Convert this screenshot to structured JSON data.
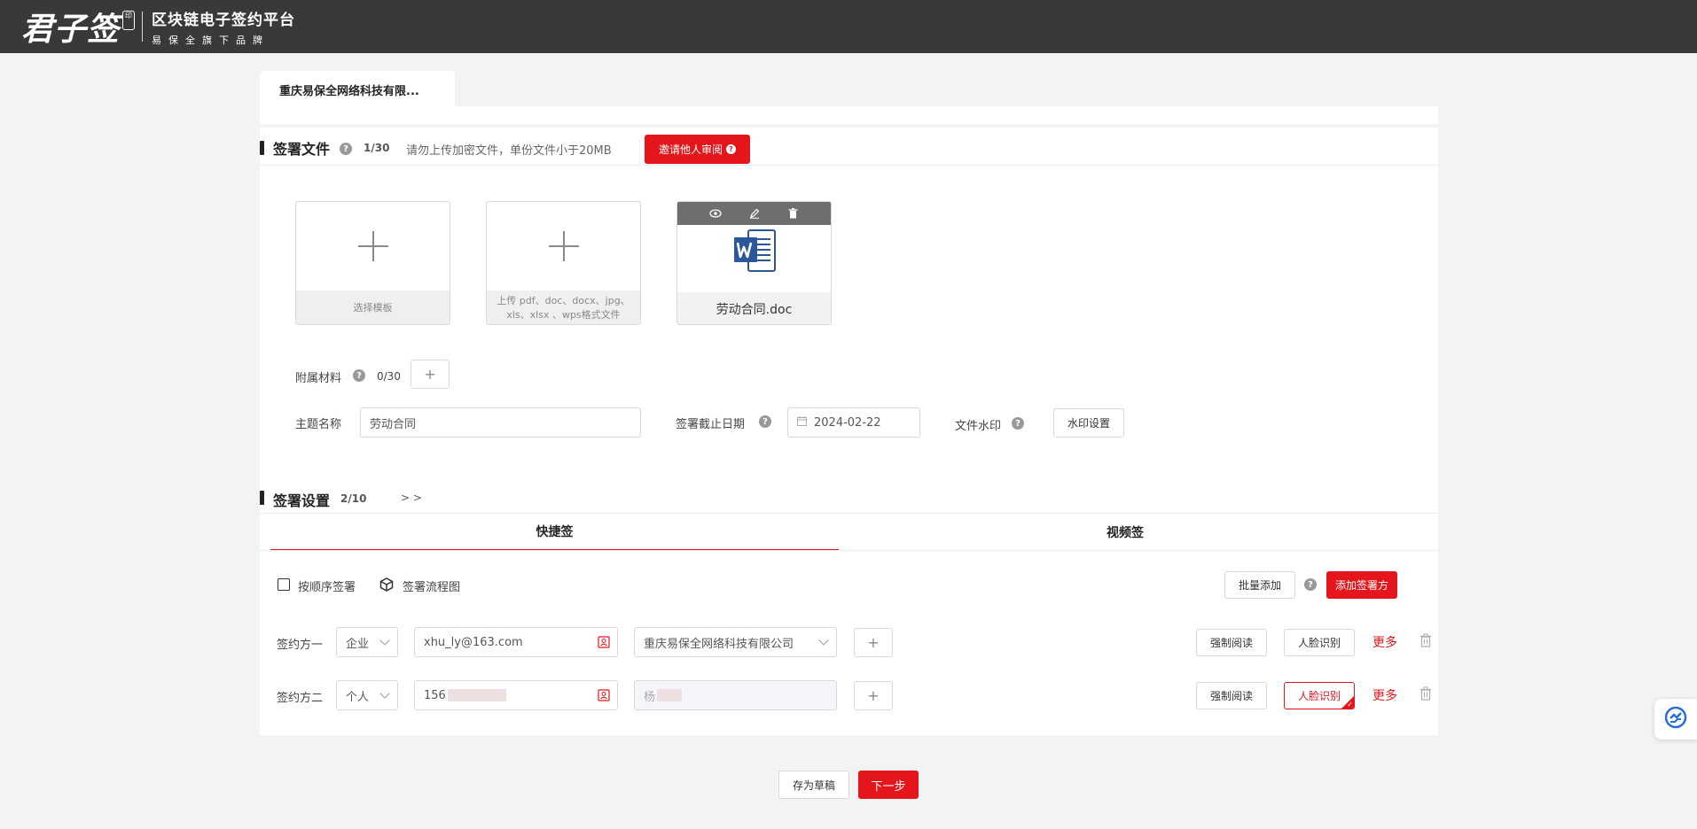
{
  "brand": {
    "logo_text": "君子签",
    "seal_text": "印",
    "platform_name": "区块链电子签约平台",
    "tagline": "易保全旗下品牌"
  },
  "company_tab": "重庆易保全网络科技有限...",
  "sign_files": {
    "title": "签署文件",
    "count": "1/30",
    "hint": "请勿上传加密文件，单份文件小于20MB",
    "invite_review_label": "邀请他人审阅",
    "template_box_label": "选择模板",
    "upload_box_label": "上传 pdf、doc、docx、jpg、xls、xlsx 、wps格式文件",
    "uploaded_file_name": "劳动合同.doc"
  },
  "attachments": {
    "label": "附属材料",
    "count": "0/30",
    "add_symbol": "+"
  },
  "form": {
    "subject_label": "主题名称",
    "subject_value": "劳动合同",
    "deadline_label": "签署截止日期",
    "deadline_value": "2024-02-22",
    "watermark_label": "文件水印",
    "watermark_button": "水印设置"
  },
  "sign_settings": {
    "title": "签署设置",
    "count": "2/10",
    "expand": "> >",
    "tabs": [
      "快捷签",
      "视频签"
    ],
    "sequential_label": "按顺序签署",
    "flowchart_label": "签署流程图",
    "batch_add_label": "批量添加",
    "add_signer_label": "添加签署方"
  },
  "signers": [
    {
      "label": "签约方一",
      "type": "企业",
      "account": "xhu_ly@163.com",
      "name": "重庆易保全网络科技有限公司",
      "name_is_select": true,
      "force_read": "强制阅读",
      "face_recognition": "人脸识别",
      "face_selected": false,
      "more": "更多"
    },
    {
      "label": "签约方二",
      "type": "个人",
      "account": "156",
      "name": "杨",
      "name_is_select": false,
      "force_read": "强制阅读",
      "face_recognition": "人脸识别",
      "face_selected": true,
      "more": "更多"
    }
  ],
  "footer": {
    "save_draft": "存为草稿",
    "next_step": "下一步"
  },
  "colors": {
    "accent": "#e4161c",
    "topbar": "#393939"
  }
}
